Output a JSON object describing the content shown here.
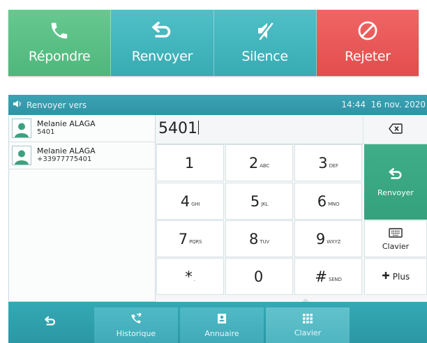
{
  "call_bar": {
    "buttons": [
      {
        "label": "Répondre",
        "icon": "phone-icon",
        "color": "#5ac184"
      },
      {
        "label": "Renvoyer",
        "icon": "forward-arrow-icon",
        "color": "#45b6bd"
      },
      {
        "label": "Silence",
        "icon": "mute-icon",
        "color": "#45b6bd"
      },
      {
        "label": "Rejeter",
        "icon": "prohibited-icon",
        "color": "#ea5757"
      }
    ]
  },
  "screen": {
    "status": {
      "title": "Renvoyer vers",
      "time": "14:44",
      "date": "16 nov. 2020"
    },
    "contacts": [
      {
        "name": "Melanie ALAGA",
        "number": "5401"
      },
      {
        "name": "Melanie ALAGA",
        "number": "+33977775401"
      }
    ],
    "entry": {
      "value": "5401"
    },
    "keypad": [
      {
        "digit": "1",
        "letters": ""
      },
      {
        "digit": "2",
        "letters": "ABC"
      },
      {
        "digit": "3",
        "letters": "DEF"
      },
      {
        "digit": "4",
        "letters": "GHI"
      },
      {
        "digit": "5",
        "letters": "JKL"
      },
      {
        "digit": "6",
        "letters": "MNO"
      },
      {
        "digit": "7",
        "letters": "PQRS"
      },
      {
        "digit": "8",
        "letters": "TUV"
      },
      {
        "digit": "9",
        "letters": "WXYZ"
      },
      {
        "digit": "*",
        "letters": "."
      },
      {
        "digit": "0",
        "letters": ""
      },
      {
        "digit": "#",
        "letters": "SEND"
      }
    ],
    "side_keys": {
      "forward_label": "Renvoyer",
      "keyboard_label": "Clavier",
      "more_label": "Plus"
    },
    "softkeys": {
      "history": "Historique",
      "directory": "Annuaire",
      "keypad": "Clavier"
    }
  }
}
